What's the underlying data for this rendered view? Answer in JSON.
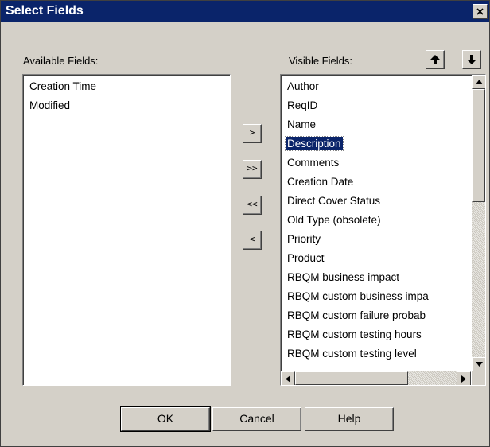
{
  "dialog": {
    "title": "Select Fields",
    "close_glyph": "×"
  },
  "available": {
    "label": "Available Fields:",
    "items": [
      "Creation Time",
      "Modified"
    ]
  },
  "visible": {
    "label": "Visible Fields:",
    "items": [
      "Author",
      "ReqID",
      "Name",
      "Description",
      "Comments",
      "Creation Date",
      "Direct Cover Status",
      "Old Type (obsolete)",
      "Priority",
      "Product",
      "RBQM business impact",
      "RBQM custom business impa",
      "RBQM custom failure probab",
      "RBQM custom testing hours",
      "RBQM custom testing level"
    ],
    "selected_index": 3
  },
  "transfer_buttons": {
    "add": ">",
    "add_all": ">>",
    "remove_all": "<<",
    "remove": "<"
  },
  "order_buttons": {
    "up_icon": "arrow-up-icon",
    "down_icon": "arrow-down-icon"
  },
  "footer": {
    "ok": "OK",
    "cancel": "Cancel",
    "help": "Help"
  },
  "colors": {
    "titlebar": "#0a246a",
    "selection": "#0a246a",
    "face": "#d4d0c8"
  }
}
